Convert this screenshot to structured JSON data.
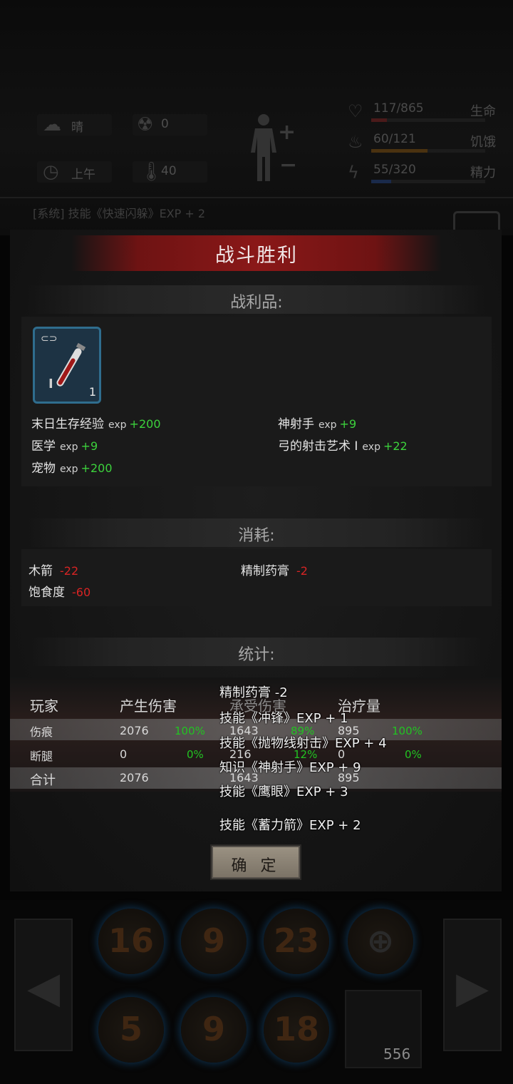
{
  "hud": {
    "weather": "晴",
    "radiation": "0",
    "time_of_day": "上午",
    "temperature": "40",
    "health_value": "117/865",
    "health_label": "生命",
    "health_pct": 13.5,
    "hunger_value": "60/121",
    "hunger_label": "饥饿",
    "hunger_pct": 49.6,
    "energy_value": "55/320",
    "energy_label": "精力",
    "energy_pct": 17.2,
    "log_text": "[系统] 技能《快速闪躲》EXP + 2"
  },
  "battle": {
    "title": "战斗胜利",
    "loot_heading": "战利品:",
    "loot_item": {
      "icon": "syringe-icon",
      "count": "1",
      "tier": "I"
    },
    "loot_lines": [
      {
        "name": "末日生存经验",
        "exp": "exp",
        "delta": "+200"
      },
      {
        "name": "神射手",
        "exp": "exp",
        "delta": "+9"
      },
      {
        "name": "医学",
        "exp": "exp",
        "delta": "+9"
      },
      {
        "name": "弓的射击艺术 I",
        "exp": "exp",
        "delta": "+22"
      },
      {
        "name": "宠物",
        "exp": "exp",
        "delta": "+200"
      }
    ],
    "consume_heading": "消耗:",
    "consume_lines": [
      {
        "name": "木箭",
        "delta": "-22"
      },
      {
        "name": "精制药膏",
        "delta": "-2"
      },
      {
        "name": "饱食度",
        "delta": "-60"
      }
    ],
    "stats_heading": "统计:",
    "stats_columns": [
      "玩家",
      "产生伤害",
      "承受伤害",
      "治疗量"
    ],
    "stats_rows": [
      {
        "name": "伤痕",
        "dealt": "2076",
        "dealt_pct": "100%",
        "taken": "1643",
        "taken_pct": "89%",
        "heal": "895",
        "heal_pct": "100%"
      },
      {
        "name": "断腿",
        "dealt": "0",
        "dealt_pct": "0%",
        "taken": "216",
        "taken_pct": "12%",
        "heal": "0",
        "heal_pct": "0%"
      },
      {
        "name": "合计",
        "dealt": "2076",
        "taken": "1643",
        "heal": "895"
      }
    ],
    "popup_lines": [
      "精制药膏 -2",
      "技能《冲锋》EXP + 1",
      "技能《抛物线射击》EXP + 4",
      "知识《神射手》EXP + 9",
      "技能《鹰眼》EXP + 3",
      "技能《蓄力箭》EXP + 2"
    ],
    "confirm_label": "确 定"
  },
  "skillbar": {
    "skills": [
      "16",
      "9",
      "23",
      "",
      "5",
      "9",
      "18"
    ],
    "slot_count": "556"
  },
  "colors": {
    "banner": "#8a1818",
    "positive": "#3cd23c",
    "negative": "#d82424",
    "item_border": "#2f6d8e"
  }
}
